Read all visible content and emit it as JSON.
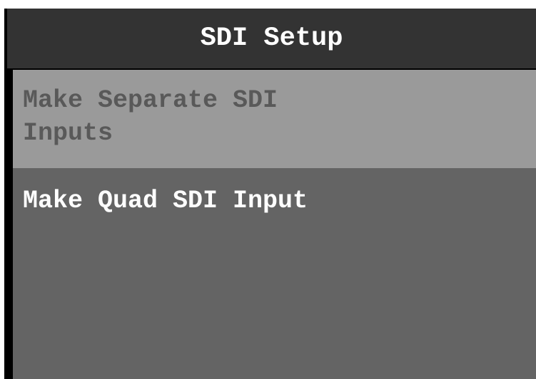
{
  "header": {
    "title": "SDI Setup"
  },
  "menu": {
    "items": [
      {
        "lines": [
          "Make Separate SDI",
          "Inputs"
        ],
        "selected": true
      },
      {
        "lines": [
          "Make Quad SDI Input"
        ],
        "selected": false
      }
    ]
  },
  "colors": {
    "title_bar_bg": "#333333",
    "menu_bg": "#646464",
    "selected_bg": "#9a9a9a",
    "selected_text": "#595959",
    "normal_text": "#ffffff"
  }
}
